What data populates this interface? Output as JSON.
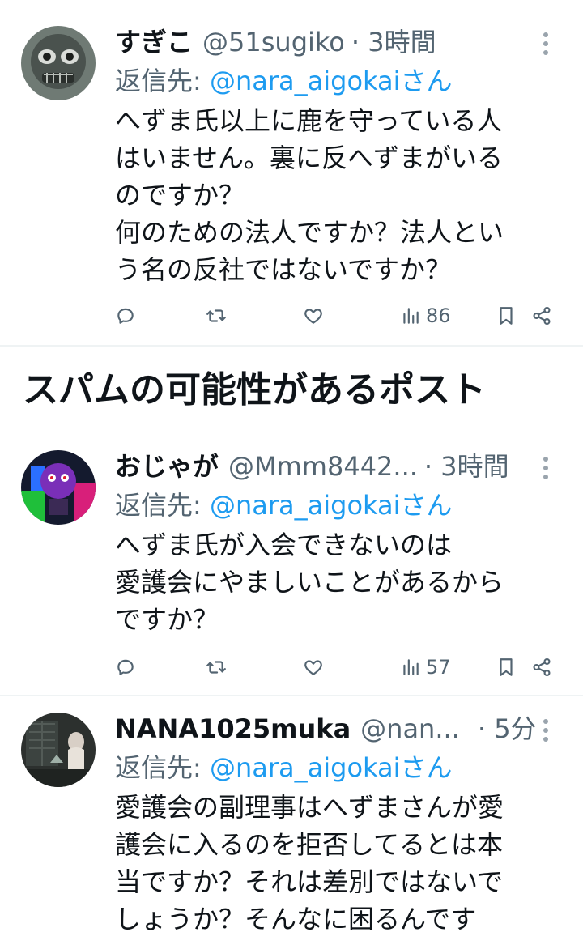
{
  "tweets": [
    {
      "name": "すぎこ",
      "handle": "@51sugiko",
      "time": "· 3時間",
      "reply_prefix": "返信先: ",
      "reply_to": "@nara_aigokaiさん",
      "body": "へずま氏以上に鹿を守っている人\nはいません。裏に反へずまがいる\nのですか？\n何のための法人ですか？法人とい\nう名の反社ではないですか？",
      "views": "86"
    },
    {
      "name": "おじゃが",
      "handle": "@Mmm8442...",
      "time": "· 3時間",
      "reply_prefix": "返信先: ",
      "reply_to": "@nara_aigokaiさん",
      "body": "へずま氏が入会できないのは\n愛護会にやましいことがあるから\nですか？",
      "views": "57"
    },
    {
      "name": "NANA1025muka",
      "handle": "@nan...",
      "time": "· 5分",
      "reply_prefix": "返信先: ",
      "reply_to": "@nara_aigokaiさん",
      "body": "愛護会の副理事はへずまさんが愛\n護会に入るのを拒否してるとは本\n当ですか？それは差別ではないで\nしょうか？そんなに困るんです"
    }
  ],
  "section": {
    "title": "スパムの可能性があるポスト"
  },
  "icons": [
    "reply-icon",
    "retweet-icon",
    "like-icon",
    "views-icon",
    "bookmark-icon",
    "share-icon",
    "more-icon"
  ],
  "colors": {
    "mention": "#1d9bf0",
    "secondary_text": "#536471",
    "divider": "#eff3f4"
  }
}
